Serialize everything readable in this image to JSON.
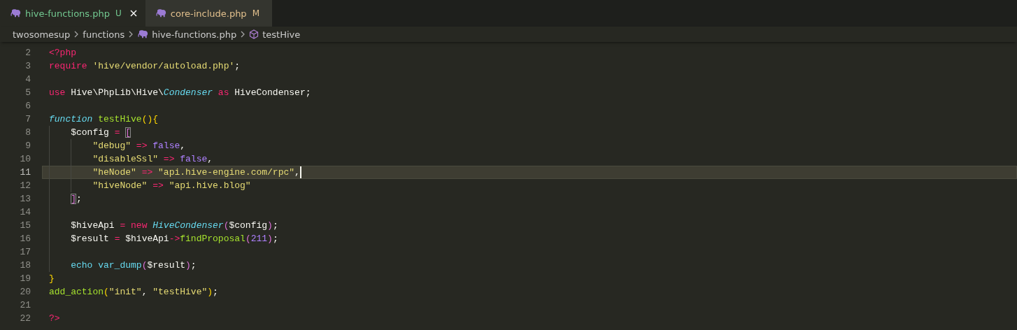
{
  "tabs": [
    {
      "label": "hive-functions.php",
      "status": "U",
      "selected": true,
      "color": "#73c991"
    },
    {
      "label": "core-include.php",
      "status": "M",
      "selected": false,
      "color": "#e2c08d"
    }
  ],
  "breadcrumb": [
    {
      "text": "twosomesup",
      "kind": "folder"
    },
    {
      "text": "functions",
      "kind": "folder"
    },
    {
      "text": "hive-functions.php",
      "kind": "file"
    },
    {
      "text": "testHive",
      "kind": "symbol"
    }
  ],
  "lines": [
    {
      "number": "2",
      "selected": false,
      "tokens": [
        {
          "kind": "kw",
          "text": "<?php"
        }
      ]
    },
    {
      "number": "3",
      "selected": false,
      "tokens": [
        {
          "kind": "kw",
          "text": "require "
        },
        {
          "kind": "str",
          "text": "'hive/vendor/autoload.php'"
        },
        {
          "kind": "plain",
          "text": ";"
        }
      ]
    },
    {
      "number": "4",
      "selected": false
    },
    {
      "number": "5",
      "selected": false,
      "tokens": [
        {
          "kind": "kw",
          "text": "use "
        },
        {
          "kind": "plain",
          "text": "Hive\\PhpLib\\Hive\\"
        },
        {
          "kind": "type",
          "text": "Condenser "
        },
        {
          "kind": "kw",
          "text": "as "
        },
        {
          "kind": "plain",
          "text": "HiveCondenser;"
        }
      ]
    },
    {
      "number": "6",
      "selected": false
    },
    {
      "number": "7",
      "selected": false,
      "tokens": [
        {
          "kind": "type",
          "text": "function "
        },
        {
          "kind": "fn",
          "text": "testHive"
        },
        {
          "kind": "b1",
          "text": "(){"
        }
      ]
    },
    {
      "number": "8",
      "selected": false,
      "tokens": [
        {
          "kind": "plain",
          "text": "    $config "
        },
        {
          "kind": "kw",
          "text": "= "
        },
        {
          "kind": "match",
          "text": "["
        }
      ]
    },
    {
      "number": "9",
      "selected": false,
      "tokens": [
        {
          "kind": "str",
          "text": "        \"debug\" "
        },
        {
          "kind": "kw",
          "text": "=> "
        },
        {
          "kind": "num",
          "text": "false"
        },
        {
          "kind": "plain",
          "text": ","
        }
      ]
    },
    {
      "number": "10",
      "selected": false,
      "tokens": [
        {
          "kind": "str",
          "text": "        \"disableSsl\" "
        },
        {
          "kind": "kw",
          "text": "=> "
        },
        {
          "kind": "num",
          "text": "false"
        },
        {
          "kind": "plain",
          "text": ","
        }
      ]
    },
    {
      "number": "11",
      "selected": true,
      "tokens": [
        {
          "kind": "str",
          "text": "        \"heNode\" "
        },
        {
          "kind": "kw",
          "text": "=> "
        },
        {
          "kind": "str",
          "text": "\"api.hive-engine.com/rpc\""
        },
        {
          "kind": "plain",
          "text": ","
        }
      ]
    },
    {
      "number": "12",
      "selected": false,
      "tokens": [
        {
          "kind": "str",
          "text": "        \"hiveNode\" "
        },
        {
          "kind": "kw",
          "text": "=> "
        },
        {
          "kind": "str",
          "text": "\"api.hive.blog\""
        }
      ]
    },
    {
      "number": "13",
      "selected": false,
      "tokens": [
        {
          "kind": "match",
          "text": "    ]"
        },
        {
          "kind": "plain",
          "text": ";"
        }
      ]
    },
    {
      "number": "14",
      "selected": false
    },
    {
      "number": "15",
      "selected": false,
      "tokens": [
        {
          "kind": "plain",
          "text": "    $hiveApi "
        },
        {
          "kind": "kw",
          "text": "= new "
        },
        {
          "kind": "type",
          "text": "HiveCondenser"
        },
        {
          "kind": "b2",
          "text": "("
        },
        {
          "kind": "plain",
          "text": "$config"
        },
        {
          "kind": "b2",
          "text": ")"
        },
        {
          "kind": "plain",
          "text": ";"
        }
      ]
    },
    {
      "number": "16",
      "selected": false,
      "tokens": [
        {
          "kind": "plain",
          "text": "    $result "
        },
        {
          "kind": "kw",
          "text": "= "
        },
        {
          "kind": "plain",
          "text": "$hiveApi"
        },
        {
          "kind": "kw",
          "text": "->"
        },
        {
          "kind": "fn",
          "text": "findProposal"
        },
        {
          "kind": "b2",
          "text": "("
        },
        {
          "kind": "num",
          "text": "211"
        },
        {
          "kind": "b2",
          "text": ")"
        },
        {
          "kind": "plain",
          "text": ";"
        }
      ]
    },
    {
      "number": "17",
      "selected": false
    },
    {
      "number": "18",
      "selected": false,
      "tokens": [
        {
          "kind": "builtin",
          "text": "    echo var_dump"
        },
        {
          "kind": "b2",
          "text": "("
        },
        {
          "kind": "plain",
          "text": "$result"
        },
        {
          "kind": "b2",
          "text": ")"
        },
        {
          "kind": "plain",
          "text": ";"
        }
      ]
    },
    {
      "number": "19",
      "selected": false,
      "tokens": [
        {
          "kind": "b1",
          "text": "}"
        }
      ]
    },
    {
      "number": "20",
      "selected": false,
      "tokens": [
        {
          "kind": "fn",
          "text": "add_action"
        },
        {
          "kind": "b1",
          "text": "("
        },
        {
          "kind": "str",
          "text": "\"init\""
        },
        {
          "kind": "plain",
          "text": ", "
        },
        {
          "kind": "str",
          "text": "\"testHive\""
        },
        {
          "kind": "b1",
          "text": ")"
        },
        {
          "kind": "plain",
          "text": ";"
        }
      ]
    },
    {
      "number": "21",
      "selected": false
    },
    {
      "number": "22",
      "selected": false,
      "tokens": [
        {
          "kind": "kw",
          "text": "?>"
        }
      ]
    }
  ]
}
